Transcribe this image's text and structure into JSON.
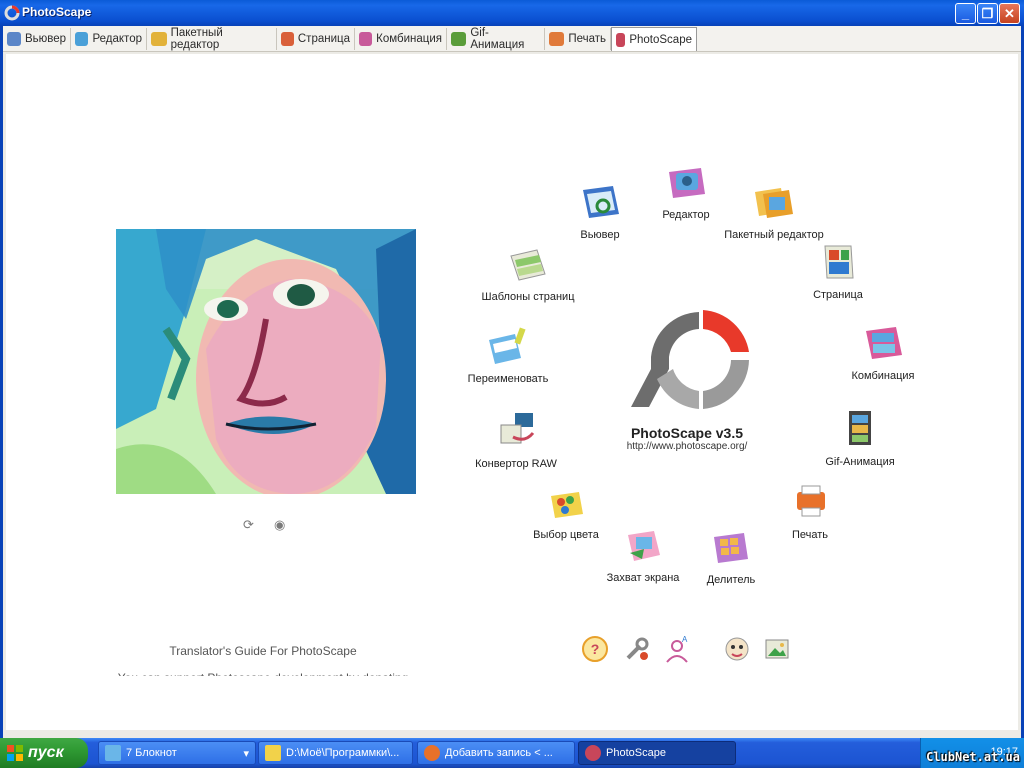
{
  "window": {
    "title": "PhotoScape",
    "minimize": "_",
    "maximize": "❐",
    "close": "✕"
  },
  "tabs": [
    {
      "label": "Вьювер"
    },
    {
      "label": "Редактор"
    },
    {
      "label": "Пакетный редактор"
    },
    {
      "label": "Страница"
    },
    {
      "label": "Комбинация"
    },
    {
      "label": "Gif-Анимация"
    },
    {
      "label": "Печать"
    },
    {
      "label": "PhotoScape"
    }
  ],
  "modules": [
    {
      "label": "Редактор"
    },
    {
      "label": "Вьювер"
    },
    {
      "label": "Пакетный редактор"
    },
    {
      "label": "Шаблоны страниц"
    },
    {
      "label": "Страница"
    },
    {
      "label": "Переименовать"
    },
    {
      "label": "Комбинация"
    },
    {
      "label": "Конвертор RAW"
    },
    {
      "label": "Gif-Анимация"
    },
    {
      "label": "Выбор цвета"
    },
    {
      "label": "Печать"
    },
    {
      "label": "Захват экрана"
    },
    {
      "label": "Делитель"
    }
  ],
  "logo": {
    "title": "PhotoScape v3.5",
    "url": "http://www.photoscape.org/"
  },
  "slideshow": {
    "refresh_icon": "refresh-icon",
    "view_icon": "eye-icon"
  },
  "footer": {
    "line1": "Translator's Guide For PhotoScape",
    "line2": "You can support Photoscape development by donating"
  },
  "bottom_icons": [
    "help-icon",
    "tools-icon",
    "language-icon",
    "face-icon",
    "screenshot-icon"
  ],
  "taskbar": {
    "start": "пуск",
    "tasks": [
      {
        "label": "7 Блокнот"
      },
      {
        "label": "D:\\Моё\\Программки\\..."
      },
      {
        "label": "Добавить запись < ..."
      },
      {
        "label": "PhotoScape"
      }
    ],
    "clock": "19:17",
    "watermark": "ClubNet.at.ua"
  },
  "colors": {
    "accent_red": "#e8392a",
    "logo_gray": "#6d6d6d",
    "tab_bg": "#f3f2ee"
  }
}
